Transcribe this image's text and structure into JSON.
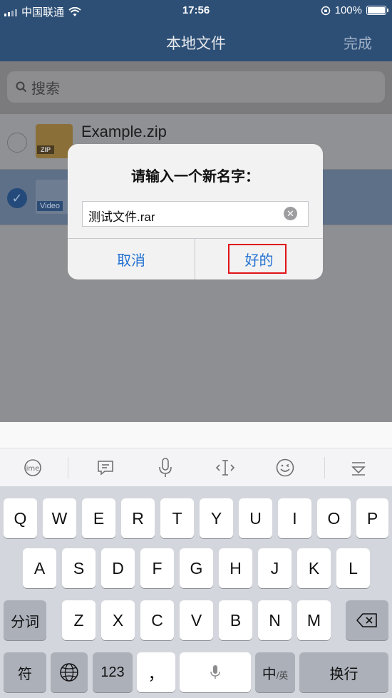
{
  "status": {
    "carrier": "中国联通",
    "time": "17:56",
    "battery": "100%"
  },
  "nav": {
    "title": "本地文件",
    "done": "完成"
  },
  "search": {
    "placeholder": "搜索"
  },
  "files": [
    {
      "name": "Example.zip",
      "type_tag": "ZIP",
      "selected": false
    },
    {
      "name": "",
      "type_tag": "Video",
      "selected": true
    }
  ],
  "dialog": {
    "title": "请输入一个新名字：",
    "input_value": "测试文件.rar",
    "cancel_label": "取消",
    "ok_label": "好的"
  },
  "keyboard": {
    "row1": [
      "Q",
      "W",
      "E",
      "R",
      "T",
      "Y",
      "U",
      "I",
      "O",
      "P"
    ],
    "row2": [
      "A",
      "S",
      "D",
      "F",
      "G",
      "H",
      "J",
      "K",
      "L"
    ],
    "row3": [
      "Z",
      "X",
      "C",
      "V",
      "B",
      "N",
      "M"
    ],
    "segment_label": "分词",
    "symbols_label": "符",
    "numbers_label": "123",
    "punct_label": "，",
    "lang_main": "中",
    "lang_sub": "/英",
    "return_label": "换行"
  },
  "colors": {
    "accent": "#2472d2",
    "highlight": "#e0141a",
    "nav_bg": "#2d4f76"
  }
}
